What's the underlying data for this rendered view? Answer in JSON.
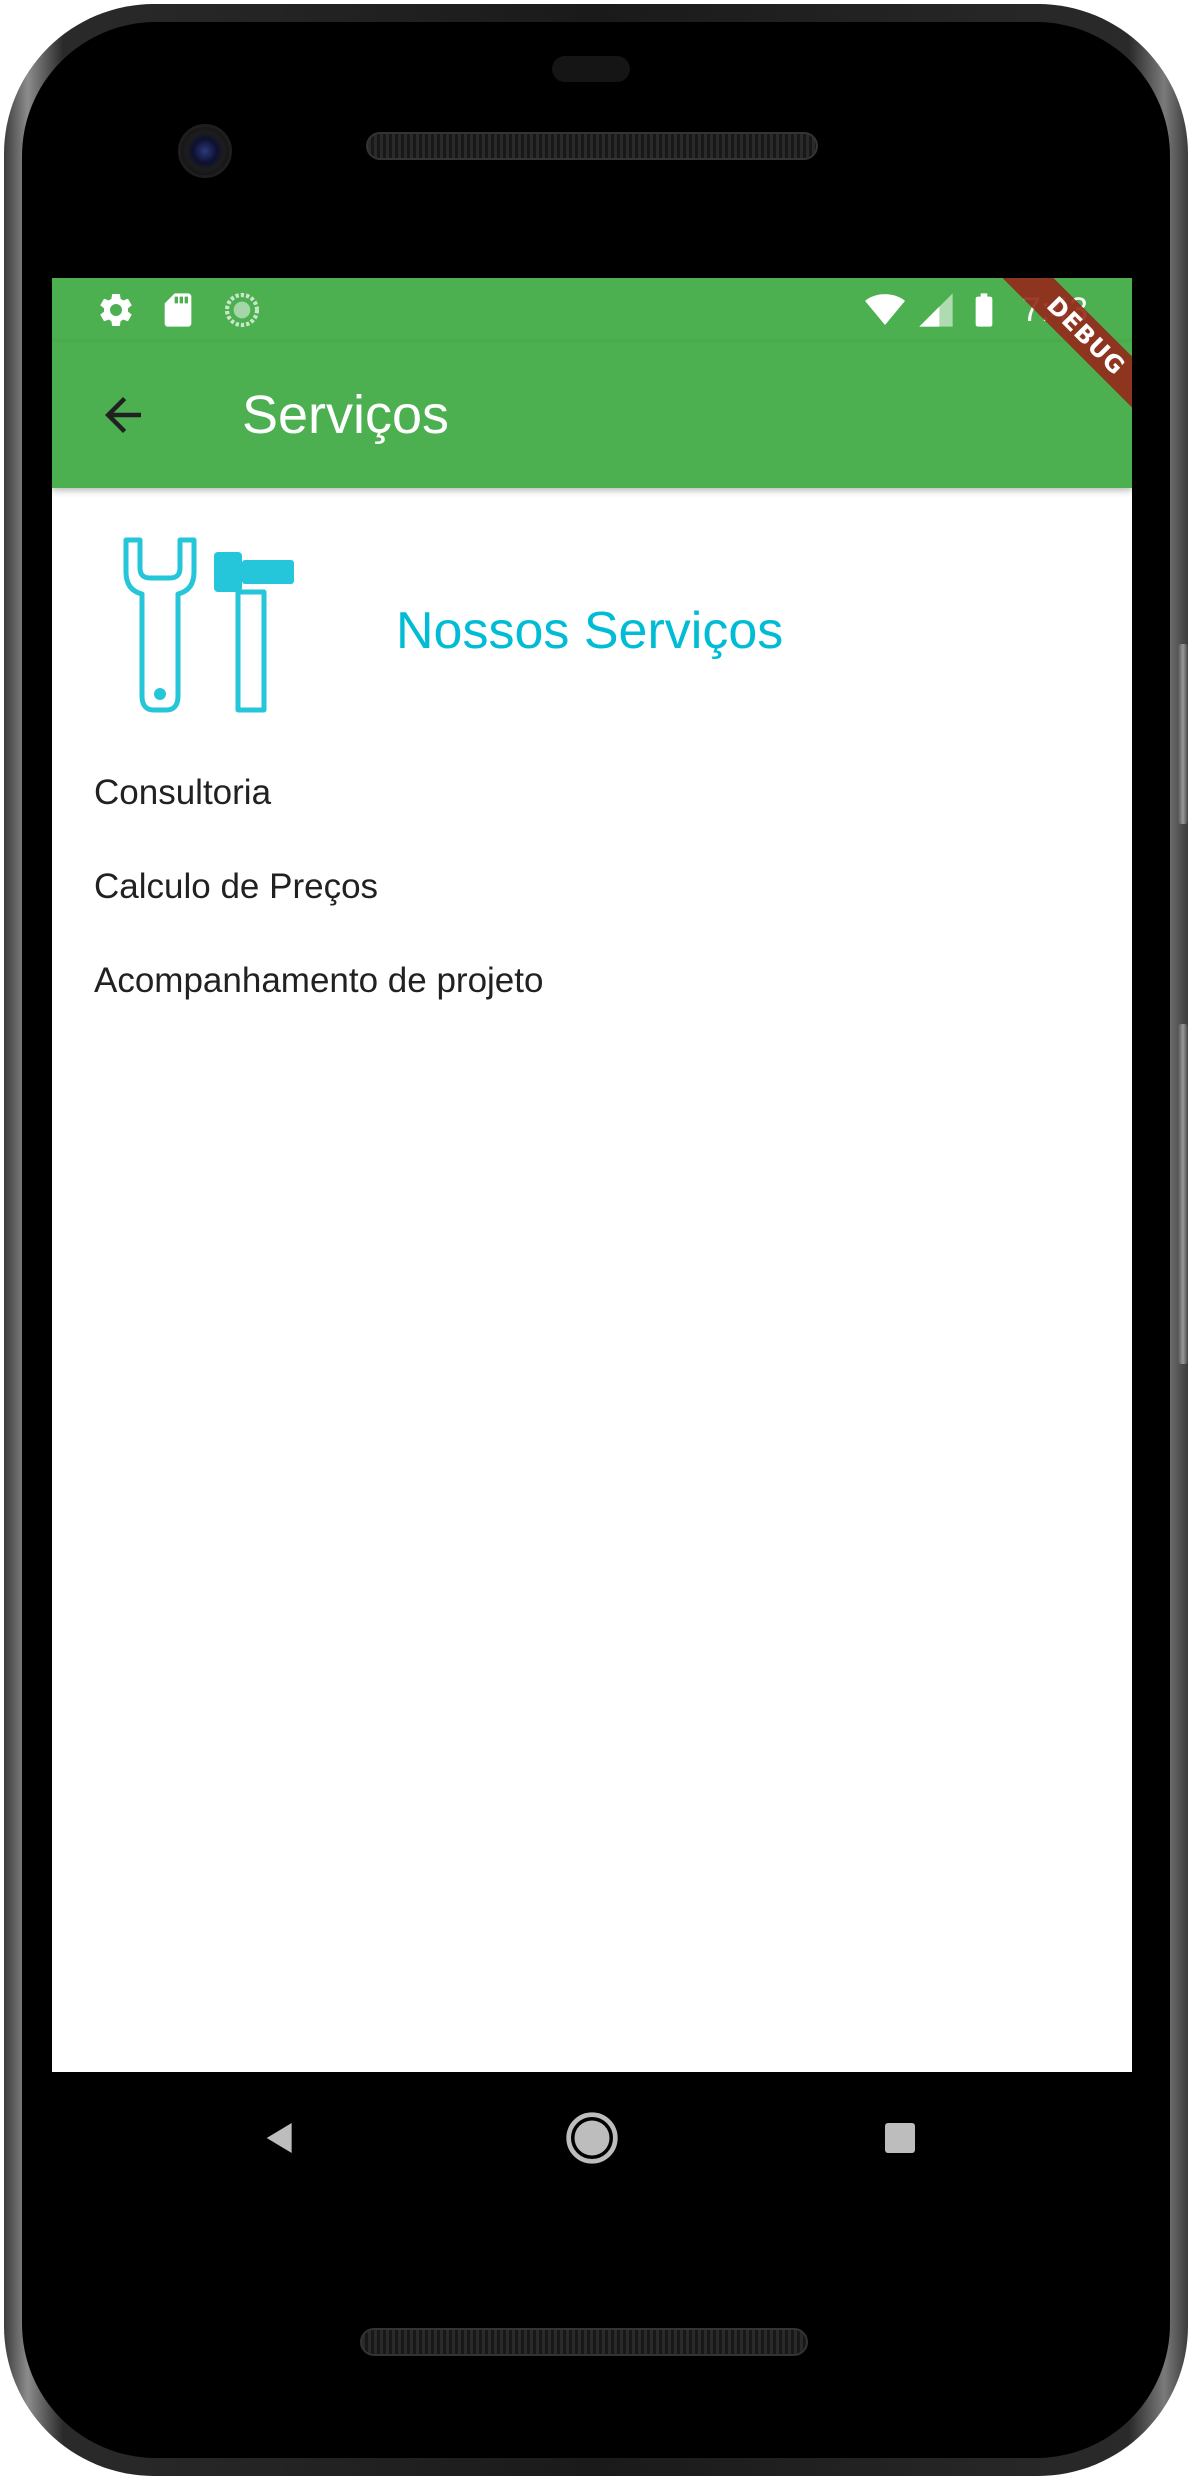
{
  "status_bar": {
    "time": "7:43",
    "left_icons": [
      "settings-icon",
      "sd-card-icon",
      "sync-icon"
    ],
    "right_icons": [
      "wifi-icon",
      "signal-icon",
      "battery-icon"
    ],
    "debug_label": "DEBUG"
  },
  "app_bar": {
    "title": "Serviços",
    "back_icon": "arrow-back-icon",
    "color": "#4caf50"
  },
  "content": {
    "icon": "tools-icon",
    "section_title": "Nossos Serviços",
    "accent_color": "#00bcd4",
    "services": [
      "Consultoria",
      "Calculo de Preços",
      "Acompanhamento de projeto"
    ]
  },
  "nav_bar": {
    "buttons": [
      "back-nav-icon",
      "home-nav-icon",
      "recents-nav-icon"
    ]
  }
}
